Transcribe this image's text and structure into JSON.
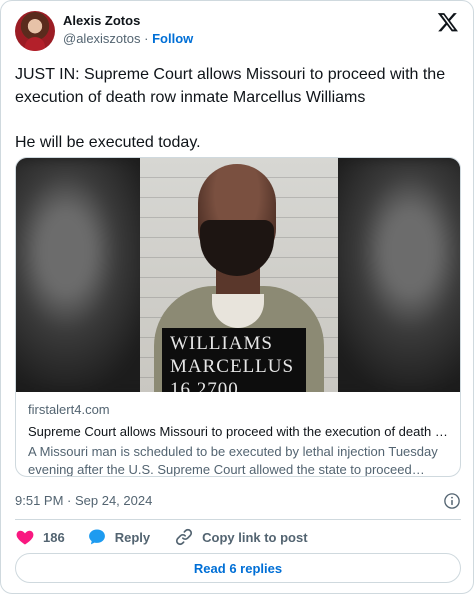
{
  "author": {
    "name": "Alexis Zotos",
    "handle": "@alexiszotos",
    "separator": "·",
    "follow_label": "Follow"
  },
  "tweet": {
    "paragraphs": [
      "JUST IN: Supreme Court allows Missouri to proceed with the execution of death row inmate Marcellus Williams",
      "He will be executed today."
    ]
  },
  "link_card": {
    "domain": "firstalert4.com",
    "title": "Supreme Court allows Missouri to proceed with the execution of death r…",
    "description": "A Missouri man is scheduled to be executed by lethal injection Tuesday evening after the U.S. Supreme Court allowed the state to proceed with…",
    "placard_lines": [
      "WILLIAMS",
      "MARCELLUS",
      "16 2700"
    ]
  },
  "timestamp": "9:51 PM · Sep 24, 2024",
  "actions": {
    "like_count": "186",
    "reply_label": "Reply",
    "copy_label": "Copy link to post"
  },
  "read_replies_label": "Read 6 replies",
  "colors": {
    "heart": "#f91880",
    "reply_bubble": "#1d9bf0",
    "link": "#006fd6",
    "muted": "#536471",
    "border": "#cfd9de"
  },
  "icons": {
    "brand": "x-logo-icon",
    "info": "info-icon",
    "like": "heart-icon",
    "reply": "speech-bubble-icon",
    "copy": "link-icon"
  }
}
